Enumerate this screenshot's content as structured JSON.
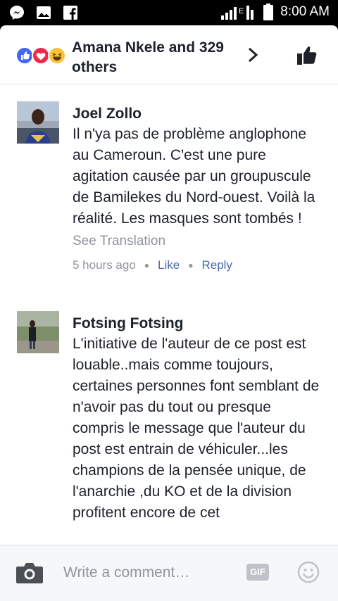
{
  "status_bar": {
    "left_icons": [
      "messenger-icon",
      "image-icon",
      "facebook-icon"
    ],
    "network_label": "E",
    "time": "8:00 AM"
  },
  "header": {
    "reaction_icons": [
      "like-reaction-icon",
      "love-reaction-icon",
      "haha-reaction-icon"
    ],
    "reactions_text": "Amana Nkele and 329 others"
  },
  "comments": [
    {
      "author": "Joel Zollo",
      "text": "Il n'ya pas de problème anglophone au Cameroun. C'est une pure agitation causée par un groupuscule de Bamilekes du Nord-ouest. Voilà la réalité. Les masques sont tombés !",
      "translate_label": "See Translation",
      "time": "5 hours ago",
      "like_label": "Like",
      "reply_label": "Reply"
    },
    {
      "author": "Fotsing Fotsing",
      "text": "L'initiative de l'auteur de ce post est louable..mais comme toujours, certaines personnes font semblant de n'avoir pas du tout ou presque compris le message que l'auteur du post est entrain de véhiculer...les champions de la pensée unique, de l'anarchie ,du KO et de la division profitent encore de cet"
    }
  ],
  "footer": {
    "placeholder": "Write a comment…",
    "gif_label": "GIF"
  },
  "colors": {
    "link": "#4b69a8",
    "meta": "#90949c",
    "text": "#1d2129",
    "like_reaction": "#4267f2",
    "love_reaction": "#f0284a",
    "haha_reaction": "#f7c23c"
  }
}
